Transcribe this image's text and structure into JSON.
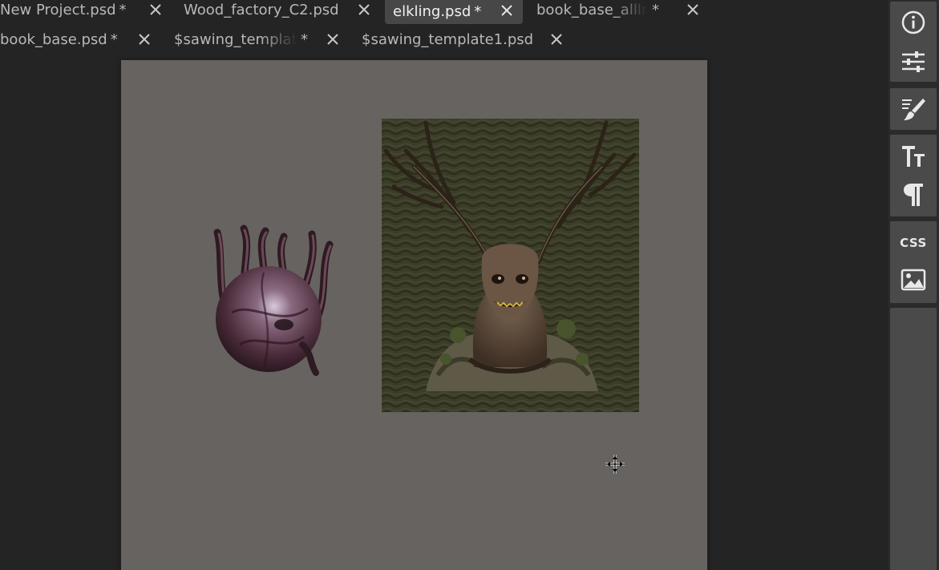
{
  "tabs": [
    {
      "label": "New Project.psd",
      "modified_mark": "*",
      "active": false
    },
    {
      "label": "Wood_factory_C2.psd",
      "modified_mark": "",
      "active": false
    },
    {
      "label": "elkling.psd",
      "modified_mark": "*",
      "active": true
    },
    {
      "label": "book_base_alllm",
      "modified_mark": "*",
      "active": false
    },
    {
      "label": "book_base.psd",
      "modified_mark": "*",
      "active": false
    },
    {
      "label": "$sawing_templat",
      "modified_mark": "*",
      "active": false
    },
    {
      "label": "$sawing_template1.psd",
      "modified_mark": "",
      "active": false
    }
  ],
  "toolbar": {
    "items": [
      {
        "icon": "info-icon"
      },
      {
        "icon": "adjustments-sliders-icon"
      },
      {
        "icon": "brush-settings-icon"
      },
      {
        "icon": "character-text-icon"
      },
      {
        "icon": "paragraph-icon"
      },
      {
        "icon": "css-icon",
        "label": "CSS"
      },
      {
        "icon": "image-icon"
      }
    ]
  },
  "colors": {
    "background": "#242424",
    "canvas": "#676360",
    "tab_active_bg": "#474747",
    "tab_text": "#b8b8b8",
    "panel_button_bg": "#4a4a4a",
    "icon": "#e8e8e8"
  }
}
